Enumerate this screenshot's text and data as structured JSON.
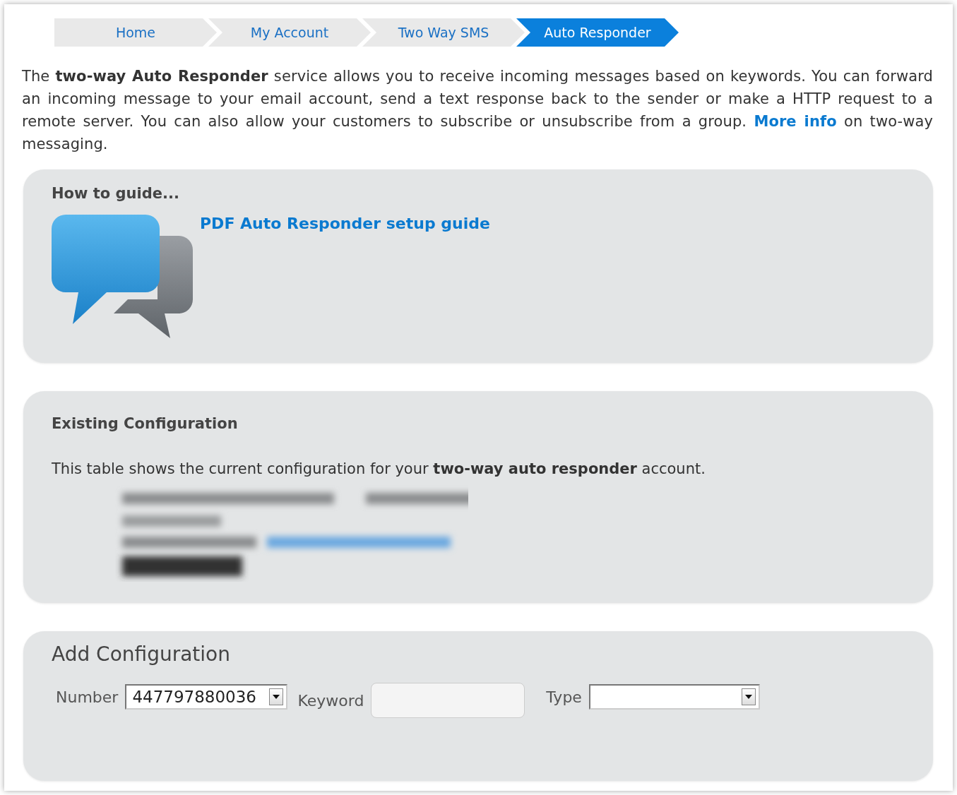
{
  "breadcrumb": [
    {
      "label": "Home",
      "selected": false
    },
    {
      "label": "My Account",
      "selected": false
    },
    {
      "label": "Two Way SMS",
      "selected": false
    },
    {
      "label": "Auto Responder",
      "selected": true
    }
  ],
  "intro": {
    "text": "The **two-way Auto Responder** service allows you to receive incoming messages based on keywords. You can forward an incoming message to your email account, send a text response back to the sender or make a HTTP request to a remote server. You can also allow your customers to subscribe or unsubscribe from a group.",
    "link": "More info",
    "after": "on two-way messaging."
  },
  "guide": {
    "heading": "How to guide...",
    "link": "PDF Auto Responder setup guide"
  },
  "existing": {
    "heading": "Existing Configuration",
    "text": "This table shows the current configuration for your **two-way auto responder** account."
  },
  "add": {
    "heading": "Add Configuration",
    "number_label": "Number",
    "number_value": "447797880036",
    "keyword_label": "Keyword",
    "type_label": "Type"
  }
}
